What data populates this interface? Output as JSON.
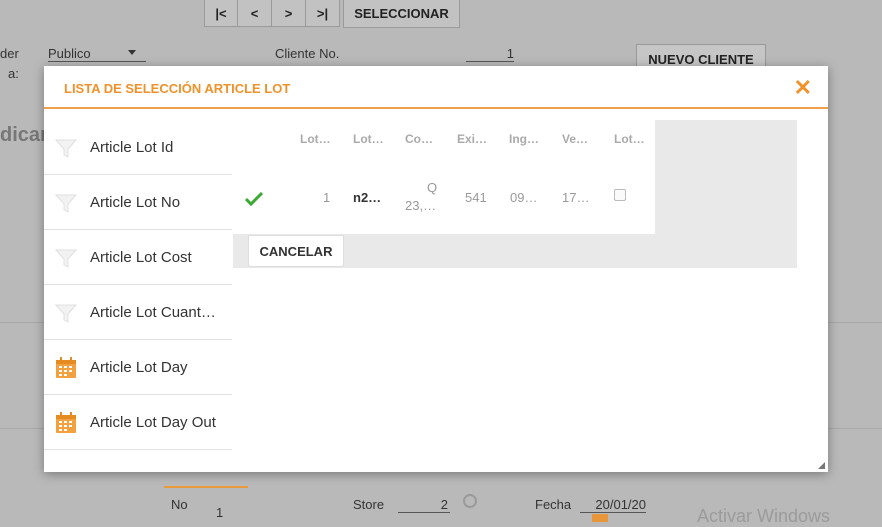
{
  "toolbar": {
    "first": "|<",
    "prev": "<",
    "next": ">",
    "last": ">|",
    "select": "SELECCIONAR"
  },
  "form": {
    "order_label_1": "der",
    "order_label_2": "a:",
    "order_value": "Publico",
    "client_label": "Cliente No.",
    "client_value": "1",
    "new_client": "NUEVO CLIENTE",
    "heading_partial": "dicar"
  },
  "footer": {
    "no_label": "No",
    "no_value": "1",
    "store_label": "Store",
    "store_value": "2",
    "fecha_label": "Fecha",
    "fecha_value": "20/01/20",
    "watermark": "Activar Windows"
  },
  "modal": {
    "title": "LISTA DE SELECCIÓN ARTICLE LOT",
    "close": "✕",
    "filters": [
      {
        "label": "Article Lot Id",
        "icon": "filter-icon"
      },
      {
        "label": "Article Lot No",
        "icon": "filter-icon"
      },
      {
        "label": "Article Lot Cost",
        "icon": "filter-icon"
      },
      {
        "label": "Article Lot Cuant…",
        "icon": "filter-icon"
      },
      {
        "label": "Article Lot Day",
        "icon": "calendar-icon"
      },
      {
        "label": "Article Lot Day Out",
        "icon": "calendar-icon"
      }
    ],
    "columns": [
      "Lot…",
      "Lot…",
      "Co…",
      "Exi…",
      "Ing…",
      "Ve…",
      "Lot…"
    ],
    "row": {
      "selected": true,
      "c1": "1",
      "c2": "n2…",
      "c3a": "Q",
      "c3b": "23,…",
      "c4": "541",
      "c5": "09…",
      "c6": "17…",
      "c7_checked": false
    },
    "cancel": "CANCELAR"
  },
  "colors": {
    "accent": "#f0922b",
    "check": "#3aaa35"
  }
}
